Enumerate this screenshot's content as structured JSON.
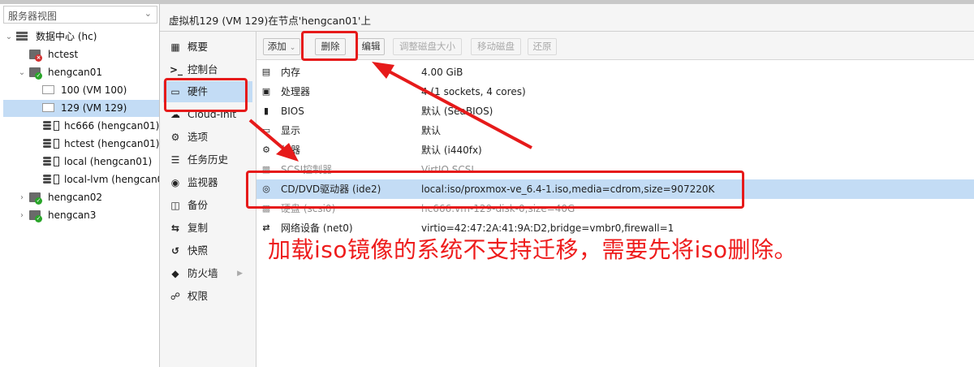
{
  "view_selector": {
    "label": "服务器视图"
  },
  "tree": {
    "datacenter": "数据中心 (hc)",
    "hctest": "hctest",
    "hengcan01": "hengcan01",
    "vm100": "100 (VM 100)",
    "vm129": "129 (VM 129)",
    "storage_hc666": "hc666 (hengcan01)",
    "storage_hctest": "hctest (hengcan01)",
    "storage_local": "local (hengcan01)",
    "storage_locallvm": "local-lvm (hengcan01)",
    "hengcan02": "hengcan02",
    "hengcan3": "hengcan3"
  },
  "title": "虚拟机129 (VM 129)在节点'hengcan01'上",
  "menu": [
    {
      "icon": "summary-icon",
      "label": "概要"
    },
    {
      "icon": "console-icon",
      "label": "控制台"
    },
    {
      "icon": "monitor-icon",
      "label": "硬件"
    },
    {
      "icon": "cloud-icon",
      "label": "Cloud-Init"
    },
    {
      "icon": "gear-icon",
      "label": "选项"
    },
    {
      "icon": "list-icon",
      "label": "任务历史"
    },
    {
      "icon": "eye-icon",
      "label": "监视器"
    },
    {
      "icon": "save-icon",
      "label": "备份"
    },
    {
      "icon": "retweet-icon",
      "label": "复制"
    },
    {
      "icon": "history-icon",
      "label": "快照"
    },
    {
      "icon": "shield-icon",
      "label": "防火墙"
    },
    {
      "icon": "unlock-icon",
      "label": "权限"
    }
  ],
  "toolbar": {
    "add": "添加",
    "remove": "删除",
    "edit": "编辑",
    "resize": "调整磁盘大小",
    "move": "移动磁盘",
    "revert": "还原"
  },
  "hardware": [
    {
      "icon": "memory-icon",
      "name": "内存",
      "value": "4.00 GiB"
    },
    {
      "icon": "cpu-icon",
      "name": "处理器",
      "value": "4 (1 sockets, 4 cores)"
    },
    {
      "icon": "bios-icon",
      "name": "BIOS",
      "value": "默认 (SeaBIOS)"
    },
    {
      "icon": "display-icon",
      "name": "显示",
      "value": "默认"
    },
    {
      "icon": "cogs-icon",
      "name": "机器",
      "value": "默认 (i440fx)"
    },
    {
      "icon": "hdd-icon",
      "name": "SCSI控制器",
      "value": "VirtIO SCSI"
    },
    {
      "icon": "cdrom-icon",
      "name": "CD/DVD驱动器 (ide2)",
      "value": "local:iso/proxmox-ve_6.4-1.iso,media=cdrom,size=907220K"
    },
    {
      "icon": "hdd-icon",
      "name": "硬盘 (scsi0)",
      "value": "hc666:vm-129-disk-0,size=40G"
    },
    {
      "icon": "exchange-icon",
      "name": "网络设备 (net0)",
      "value": "virtio=42:47:2A:41:9A:D2,bridge=vmbr0,firewall=1"
    }
  ],
  "annotation": {
    "caption": "加载iso镜像的系统不支持迁移，需要先将iso删除。",
    "color": "#ee1c1c"
  }
}
